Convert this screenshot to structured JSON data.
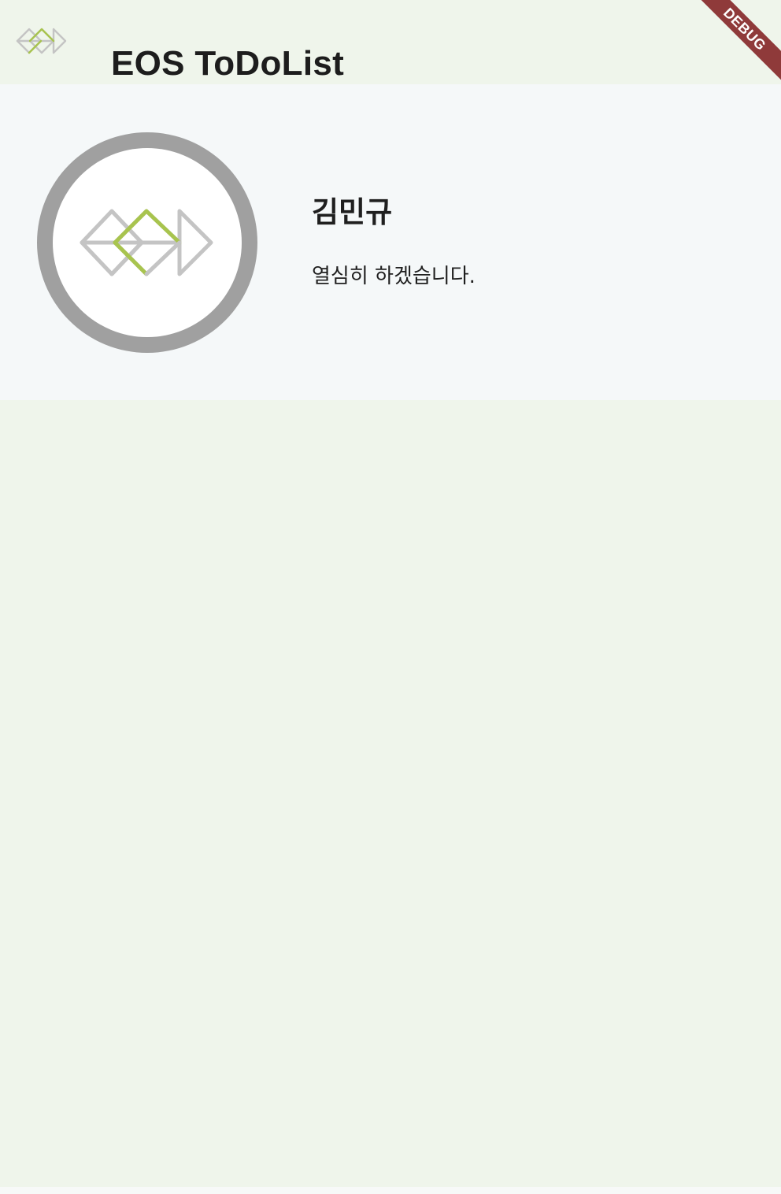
{
  "app_bar": {
    "title": "EOS ToDoList",
    "logo_icon": "eos-diamond-logo-icon"
  },
  "debug_banner": {
    "label": "DEBUG",
    "color": "#8f3a3a"
  },
  "profile": {
    "name": "김민규",
    "motto": "열심히 하겠습니다.",
    "avatar_icon": "eos-diamond-logo-icon",
    "avatar_ring_color": "#a0a0a0"
  },
  "colors": {
    "background": "#eff5eb",
    "card": "#f5f8f9",
    "logo_gray": "#c4c4c4",
    "logo_green": "#a8c44e",
    "text": "#1f1f1f"
  }
}
